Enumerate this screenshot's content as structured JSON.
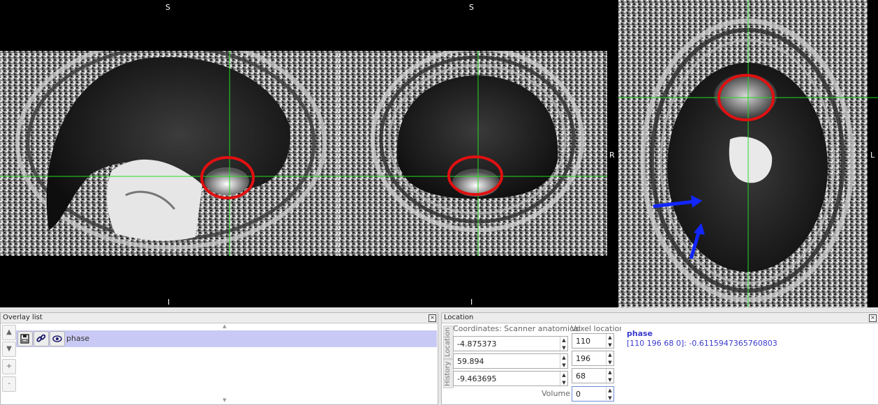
{
  "views": {
    "sagittal": {
      "top": "S",
      "bottom": "I"
    },
    "coronal": {
      "top": "S",
      "bottom": "I",
      "right": "R"
    },
    "axial": {
      "right": "L"
    }
  },
  "colors": {
    "crosshair": "#22dd22",
    "highlight_circle": "#e11010",
    "annotation_arrow": "#1226ff",
    "overlay_selected_row": "#c9c9f5",
    "info_text": "#3a3ad0"
  },
  "overlay_list": {
    "title": "Overlay list",
    "items": [
      {
        "name": "phase",
        "selected": true,
        "icons": [
          "save-icon",
          "link-icon",
          "eye-icon"
        ]
      }
    ],
    "side_buttons": [
      "up-arrow-icon",
      "down-arrow-icon",
      "plus-icon",
      "minus-icon"
    ]
  },
  "location": {
    "title": "Location",
    "tabs": [
      "Location",
      "History"
    ],
    "coordinates_label": "Coordinates: Scanner anatomical",
    "voxel_label": "Voxel location",
    "coords": [
      "-4.875373",
      "59.894",
      "-9.463695"
    ],
    "voxels": [
      "110",
      "196",
      "68"
    ],
    "volume_label": "Volume",
    "volume_value": "0",
    "info": {
      "name": "phase",
      "value_line": "[110 196 68 0]: -0.6115947365760803"
    }
  }
}
